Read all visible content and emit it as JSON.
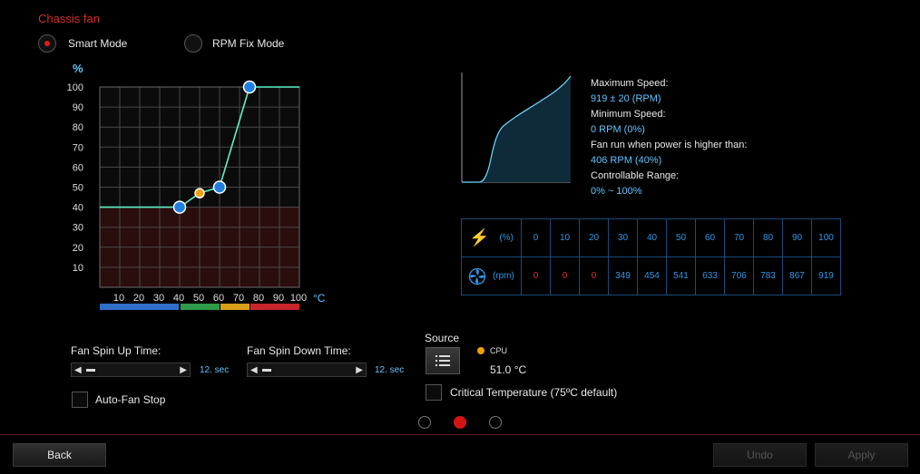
{
  "panel": {
    "title": "Chassis fan"
  },
  "modes": [
    {
      "label": "Smart Mode",
      "selected": true
    },
    {
      "label": "RPM Fix Mode",
      "selected": false
    }
  ],
  "curve": {
    "y_unit": "%",
    "x_unit": "°C",
    "y_ticks": [
      "100",
      "90",
      "80",
      "70",
      "60",
      "50",
      "40",
      "30",
      "20",
      "10"
    ],
    "x_ticks": [
      "10",
      "20",
      "30",
      "40",
      "50",
      "60",
      "70",
      "80",
      "90",
      "100"
    ],
    "points": [
      {
        "temp": 40,
        "speed": 40
      },
      {
        "temp": 50,
        "speed": 47
      },
      {
        "temp": 60,
        "speed": 50
      },
      {
        "temp": 75,
        "speed": 100
      }
    ],
    "color_bands": [
      "#2f6fc8",
      "#2e9a4a",
      "#d8a018",
      "#c8262a"
    ]
  },
  "info": {
    "max_speed_label": "Maximum Speed:",
    "max_speed_value": "919 ± 20 (RPM)",
    "min_speed_label": "Minimum Speed:",
    "min_speed_value": "0 RPM (0%)",
    "power_label": "Fan run when power is higher than:",
    "power_value": "406 RPM (40%)",
    "range_label": "Controllable Range:",
    "range_value": "0% ~ 100%"
  },
  "rpm_table": {
    "pct_header": "(%)",
    "rpm_header": "(rpm)",
    "percent": [
      "0",
      "10",
      "20",
      "30",
      "40",
      "50",
      "60",
      "70",
      "80",
      "90",
      "100"
    ],
    "rpm": [
      "0",
      "0",
      "0",
      "349",
      "454",
      "541",
      "633",
      "706",
      "783",
      "867",
      "919"
    ]
  },
  "spin_up": {
    "label": "Fan Spin Up Time:",
    "value": "12. sec"
  },
  "spin_down": {
    "label": "Fan Spin Down Time:",
    "value": "12. sec"
  },
  "source": {
    "label": "Source",
    "sensor": "CPU",
    "temperature": "51.0 °C",
    "sensor_color": "#f0a000"
  },
  "auto_fan_stop": {
    "label": "Auto-Fan Stop",
    "checked": false
  },
  "critical_temp": {
    "label": "Critical Temperature (75ºC default)",
    "checked": false
  },
  "pagination": {
    "pages": 3,
    "current": 2
  },
  "buttons": {
    "back": "Back",
    "undo": "Undo",
    "apply": "Apply"
  }
}
